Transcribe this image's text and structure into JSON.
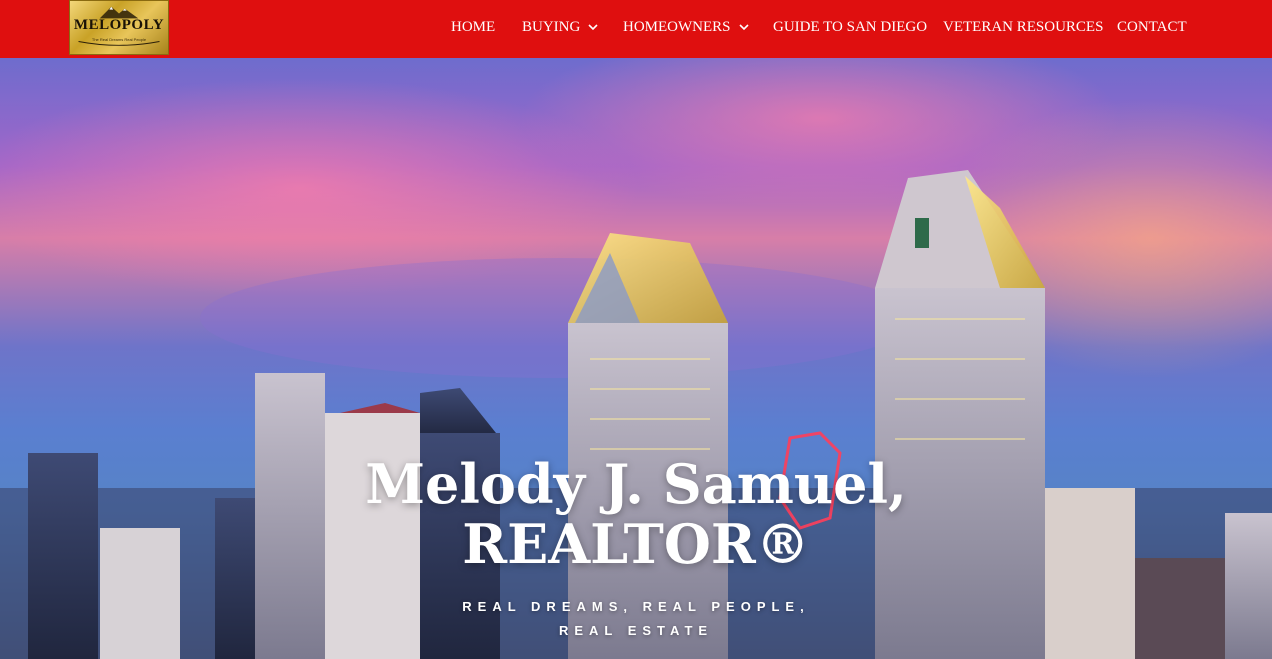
{
  "logo": {
    "name": "MELOPOLY",
    "tagline": "The Real Dreams Real People"
  },
  "nav": {
    "items": [
      {
        "label": "HOME",
        "has_dropdown": false
      },
      {
        "label": "BUYING",
        "has_dropdown": true
      },
      {
        "label": "HOMEOWNERS",
        "has_dropdown": true
      },
      {
        "label": "GUIDE TO SAN DIEGO",
        "has_dropdown": false
      },
      {
        "label": "VETERAN RESOURCES",
        "has_dropdown": false
      },
      {
        "label": "CONTACT",
        "has_dropdown": false
      }
    ]
  },
  "hero": {
    "title_line1": "Melody J. Samuel,",
    "title_line2": "REALTOR®",
    "subtitle_line1": "REAL DREAMS, REAL PEOPLE,",
    "subtitle_line2": "REAL ESTATE"
  },
  "colors": {
    "navbar": "#df0f0f",
    "nav_text": "#ffffff",
    "logo_gold": "#c9a227"
  }
}
